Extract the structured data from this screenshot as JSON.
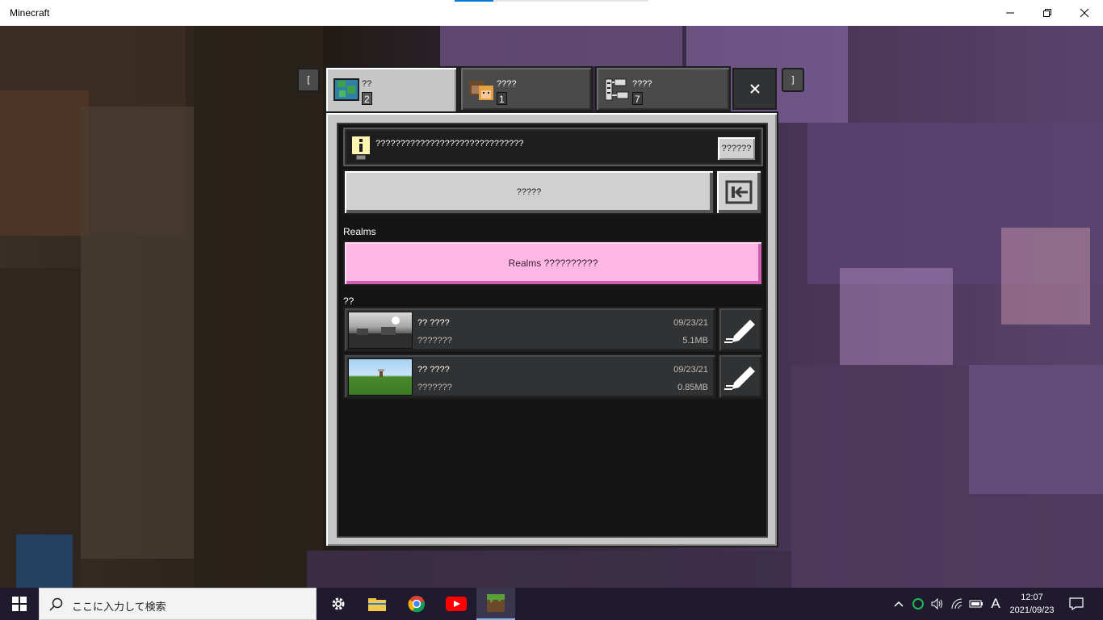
{
  "window": {
    "title": "Minecraft",
    "minimize_icon": "minimize-icon",
    "restore_icon": "restore-icon",
    "close_icon": "close-icon"
  },
  "dialog": {
    "left_bracket": "[",
    "right_bracket": "]",
    "tabs": [
      {
        "label": "??",
        "count": "2",
        "icon": "world-icon",
        "active": true
      },
      {
        "label": "????",
        "count": "1",
        "icon": "friends-icon",
        "active": false
      },
      {
        "label": "????",
        "count": "7",
        "icon": "servers-icon",
        "active": false
      }
    ],
    "close_label": "×"
  },
  "info": {
    "text": "??????????????????????????????",
    "button": "??????"
  },
  "create": {
    "label": "?????"
  },
  "realms": {
    "section_label": "Realms",
    "button": "Realms ??????????"
  },
  "worlds": {
    "section_label": "??",
    "items": [
      {
        "name": "?? ????",
        "mode": "???????",
        "date": "09/23/21",
        "size": "5.1MB"
      },
      {
        "name": "?? ????",
        "mode": "???????",
        "date": "09/23/21",
        "size": "0.85MB"
      }
    ]
  },
  "taskbar": {
    "search_placeholder": "ここに入力して検索",
    "ime": "A",
    "time": "12:07",
    "date": "2021/09/23"
  }
}
